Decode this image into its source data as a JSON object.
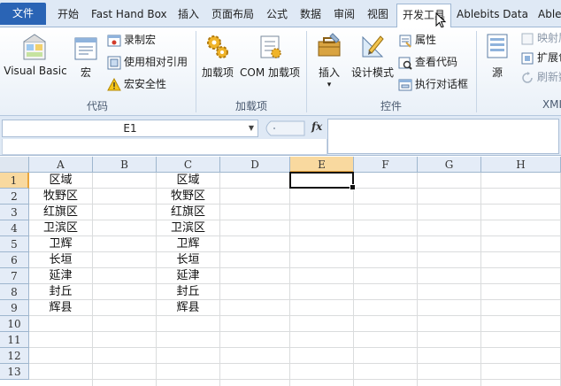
{
  "tabs": [
    {
      "label": "文件",
      "left": 0
    },
    {
      "label": "开始"
    },
    {
      "label": "Fast Hand Box"
    },
    {
      "label": "插入"
    },
    {
      "label": "页面布局"
    },
    {
      "label": "公式"
    },
    {
      "label": "数据"
    },
    {
      "label": "审阅"
    },
    {
      "label": "视图"
    },
    {
      "label": "开发工具"
    },
    {
      "label": "Ablebits Data"
    },
    {
      "label": "Able"
    }
  ],
  "ribbon": {
    "code": {
      "label": "代码",
      "visual_basic": "Visual Basic",
      "macro": "宏",
      "record_macro": "录制宏",
      "relative_ref": "使用相对引用",
      "macro_security": "宏安全性"
    },
    "addins": {
      "label": "加载项",
      "addins": "加载项",
      "com_addins": "COM 加载项"
    },
    "controls": {
      "label": "控件",
      "insert": "插入",
      "insert_arrow": "▾",
      "design_mode": "设计模式",
      "properties": "属性",
      "view_code": "查看代码",
      "run_dialog": "执行对话框"
    },
    "xml": {
      "label": "XMI",
      "source": "源",
      "map_properties": "映射属",
      "expansion_packs": "扩展包",
      "refresh_data": "刷新数"
    }
  },
  "formula_bar": {
    "name_box": "E1",
    "name_dropdown": "▼",
    "fx": "fx",
    "formula": ""
  },
  "grid": {
    "columns": [
      "A",
      "B",
      "C",
      "D",
      "E",
      "F",
      "G",
      "H"
    ],
    "selected_column": "E",
    "rows": [
      "1",
      "2",
      "3",
      "4",
      "5",
      "6",
      "7",
      "8",
      "9",
      "10",
      "11",
      "12",
      "13"
    ],
    "selected_row": "1",
    "active_cell": "E1",
    "col_a": [
      "区域",
      "牧野区",
      "红旗区",
      "卫滨区",
      "卫辉",
      "长垣",
      "延津",
      "封丘",
      "辉县"
    ],
    "col_c": [
      "区域",
      "牧野区",
      "红旗区",
      "卫滨区",
      "卫辉",
      "长垣",
      "延津",
      "封丘",
      "辉县"
    ]
  },
  "colors": {
    "file_tab": "#2a64b5",
    "selected_header": "#f9d99f",
    "selected_header_border": "#e9a53c",
    "gridline": "#dadcdd"
  }
}
